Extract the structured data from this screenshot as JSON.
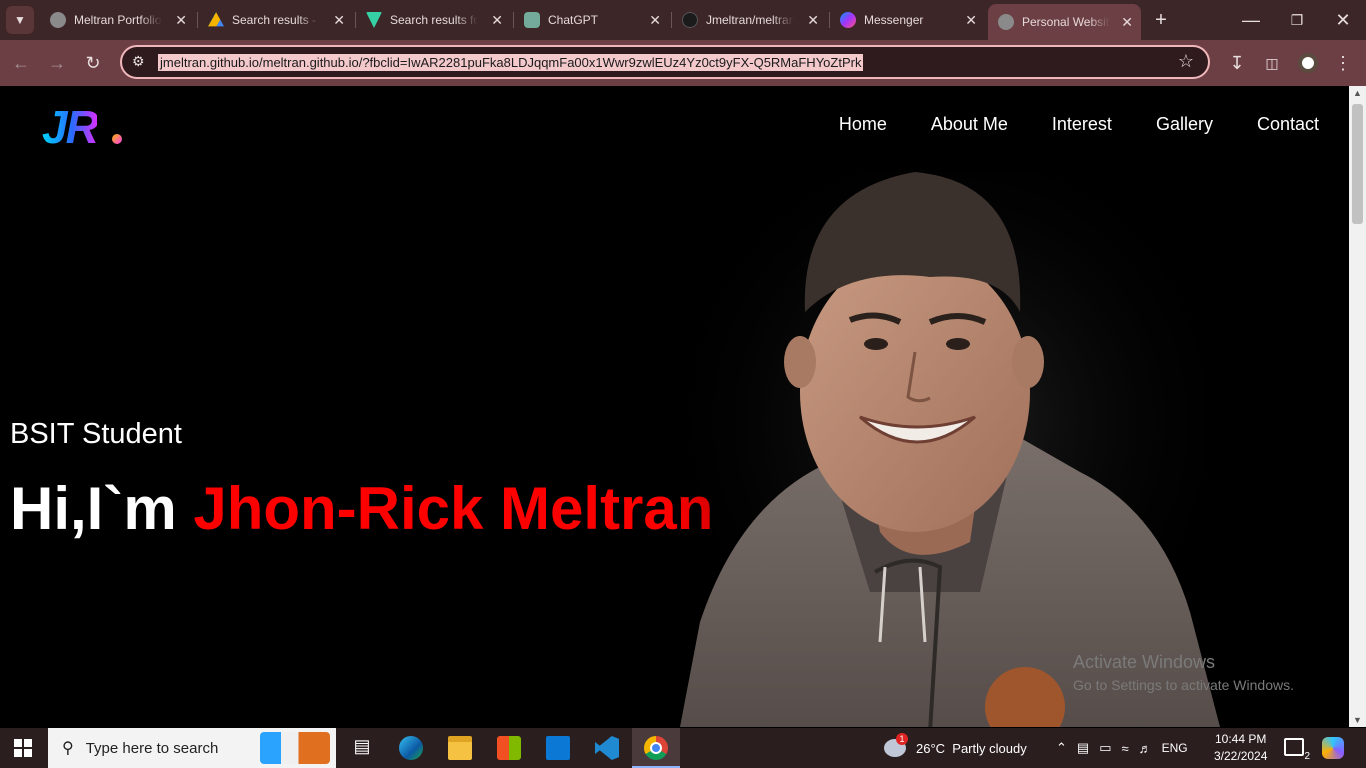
{
  "browser": {
    "tabs": [
      {
        "title": "Meltran Portfolio",
        "favicon": "globe-icon",
        "color": "#9a9a9a"
      },
      {
        "title": "Search results - Google Drive",
        "favicon": "google-drive-icon",
        "color": "#f4b400"
      },
      {
        "title": "Search results for",
        "favicon": "v-logo-icon",
        "color": "#36d0a5"
      },
      {
        "title": "ChatGPT",
        "favicon": "chatgpt-icon",
        "color": "#74aa9c"
      },
      {
        "title": "Jmeltran/meltran",
        "favicon": "github-icon",
        "color": "#222222"
      },
      {
        "title": "Messenger",
        "favicon": "messenger-icon",
        "color": "#a334fa"
      },
      {
        "title": "Personal Website",
        "favicon": "globe-icon",
        "color": "#9a9a9a",
        "active": true
      }
    ],
    "url": "jmeltran.github.io/meltran.github.io/?fbclid=IwAR2281puFka8LDJqqmFa00x1Wwr9zwlEUz4Yz0ct9yFX-Q5RMaFHYoZtPrk"
  },
  "site": {
    "logo_text": "JR",
    "nav": [
      "Home",
      "About Me",
      "Interest",
      "Gallery",
      "Contact"
    ],
    "subtitle": "BSIT Student",
    "headline_prefix": "Hi,I`m ",
    "headline_name": "Jhon-Rick Meltran",
    "name_color": "#ff0000"
  },
  "watermark": {
    "line1": "Activate Windows",
    "line2": "Go to Settings to activate Windows."
  },
  "taskbar": {
    "search_placeholder": "Type here to search",
    "weather": "26°C  Partly cloudy",
    "language": "ENG",
    "time": "10:44 PM",
    "date": "3/22/2024",
    "notification_count": "2",
    "weather_badge": "1"
  }
}
